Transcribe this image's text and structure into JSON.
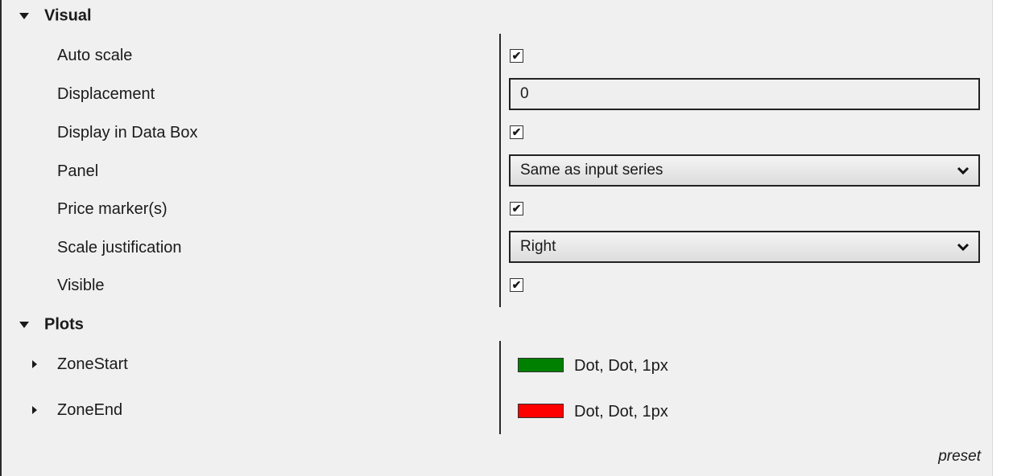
{
  "sections": {
    "visual": {
      "title": "Visual",
      "rows": [
        {
          "label": "Auto scale",
          "type": "checkbox",
          "checked": true
        },
        {
          "label": "Displacement",
          "type": "text",
          "value": "0"
        },
        {
          "label": "Display in Data Box",
          "type": "checkbox",
          "checked": true
        },
        {
          "label": "Panel",
          "type": "select",
          "value": "Same as input series"
        },
        {
          "label": "Price marker(s)",
          "type": "checkbox",
          "checked": true
        },
        {
          "label": "Scale justification",
          "type": "select",
          "value": "Right"
        },
        {
          "label": "Visible",
          "type": "checkbox",
          "checked": true
        }
      ]
    },
    "plots": {
      "title": "Plots",
      "items": [
        {
          "label": "ZoneStart",
          "color": "#008000",
          "style": "Dot, Dot, 1px"
        },
        {
          "label": "ZoneEnd",
          "color": "#ff0000",
          "style": "Dot, Dot, 1px"
        }
      ]
    }
  },
  "footer": {
    "preset": "preset"
  },
  "icons": {
    "expanded": "triangle-down-icon",
    "collapsed": "triangle-right-icon",
    "dropdown": "chevron-down-icon",
    "check": "checkmark-icon"
  },
  "glyphs": {
    "check": "✔"
  }
}
